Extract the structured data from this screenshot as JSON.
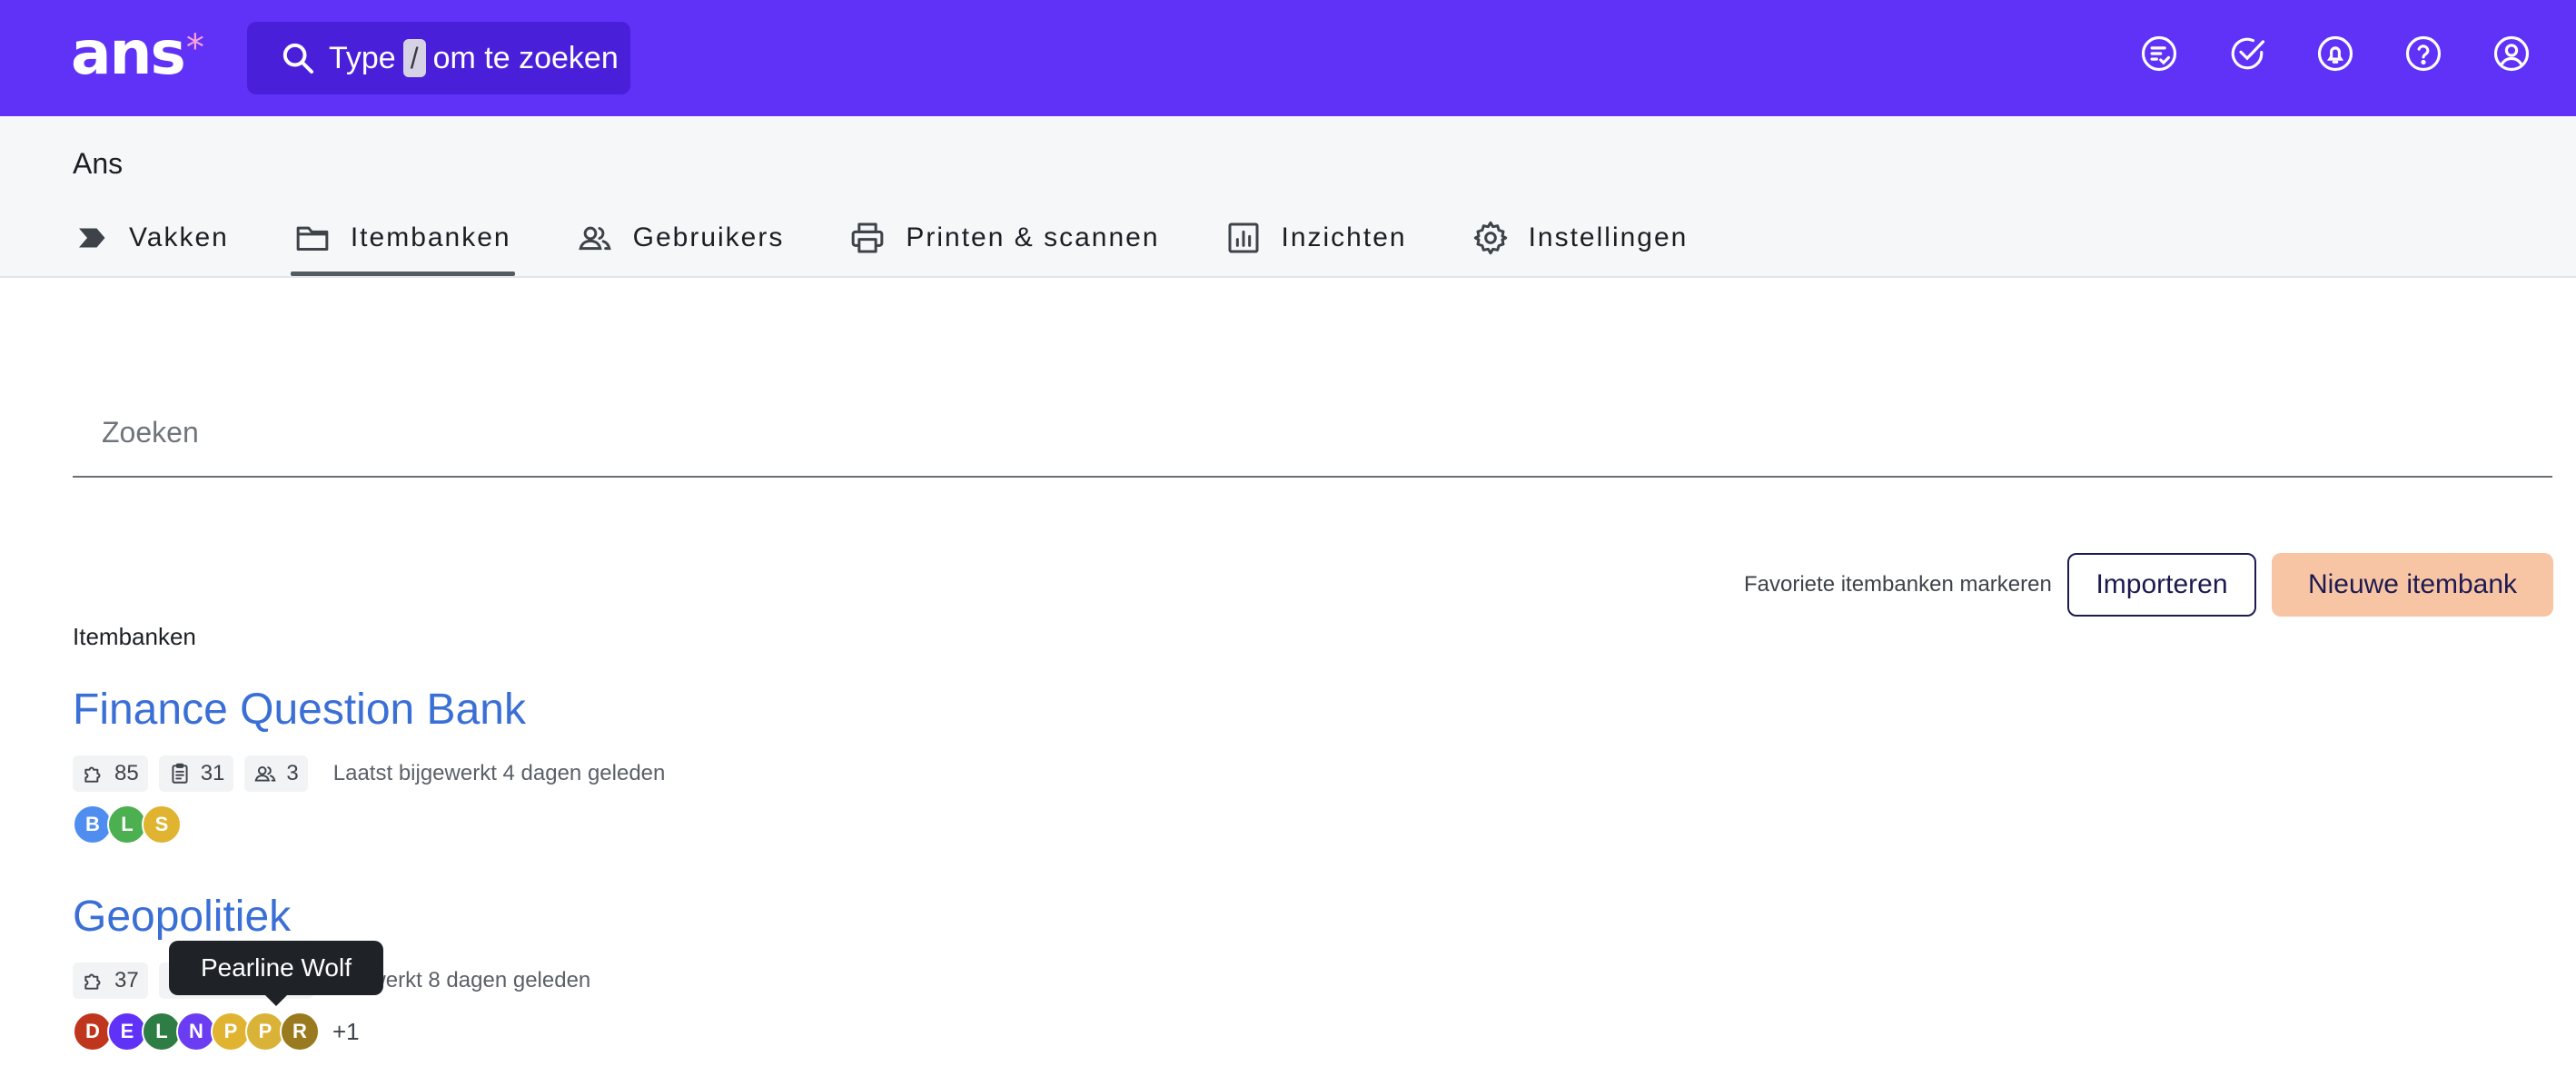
{
  "header": {
    "logo_text": "ans",
    "logo_mark": "*",
    "search": {
      "prefix": "Type",
      "key": "/",
      "suffix": "om te zoeken"
    },
    "icons": [
      "task-list-icon",
      "check-circle-icon",
      "bell-icon",
      "help-icon",
      "account-icon"
    ]
  },
  "org": {
    "title": "Ans"
  },
  "tabs": [
    {
      "label": "Vakken",
      "icon": "tag-icon"
    },
    {
      "label": "Itembanken",
      "icon": "folder-icon",
      "active": true
    },
    {
      "label": "Gebruikers",
      "icon": "users-icon"
    },
    {
      "label": "Printen & scannen",
      "icon": "printer-icon"
    },
    {
      "label": "Inzichten",
      "icon": "chart-icon"
    },
    {
      "label": "Instellingen",
      "icon": "gear-icon"
    }
  ],
  "search_field": {
    "placeholder": "Zoeken"
  },
  "actions": {
    "favorites_link": "Favoriete itembanken markeren",
    "import_label": "Importeren",
    "new_label": "Nieuwe itembank"
  },
  "section_label": "Itembanken",
  "banks": [
    {
      "title": "Finance Question Bank",
      "items": "85",
      "exercises": "31",
      "users": "3",
      "updated": "Laatst bijgewerkt 4 dagen geleden",
      "avatars": [
        {
          "letter": "B",
          "color": "#4f8ef0"
        },
        {
          "letter": "L",
          "color": "#4caf50"
        },
        {
          "letter": "S",
          "color": "#e0b431"
        }
      ],
      "extra": ""
    },
    {
      "title": "Geopolitiek",
      "items": "37",
      "updated": "bijgewerkt 8 dagen geleden",
      "avatars": [
        {
          "letter": "D",
          "color": "#c0361d"
        },
        {
          "letter": "E",
          "color": "#6032f7"
        },
        {
          "letter": "L",
          "color": "#2e7d44"
        },
        {
          "letter": "N",
          "color": "#6a3cf2"
        },
        {
          "letter": "P",
          "color": "#e0b431"
        },
        {
          "letter": "P",
          "color": "#d9b338"
        },
        {
          "letter": "R",
          "color": "#9a7a1e"
        }
      ],
      "extra": "+1"
    }
  ],
  "tooltip": {
    "text": "Pearline Wolf"
  },
  "colors": {
    "brand": "#6032f7",
    "link": "#3a6fd6",
    "cta": "#f7c5a3"
  }
}
